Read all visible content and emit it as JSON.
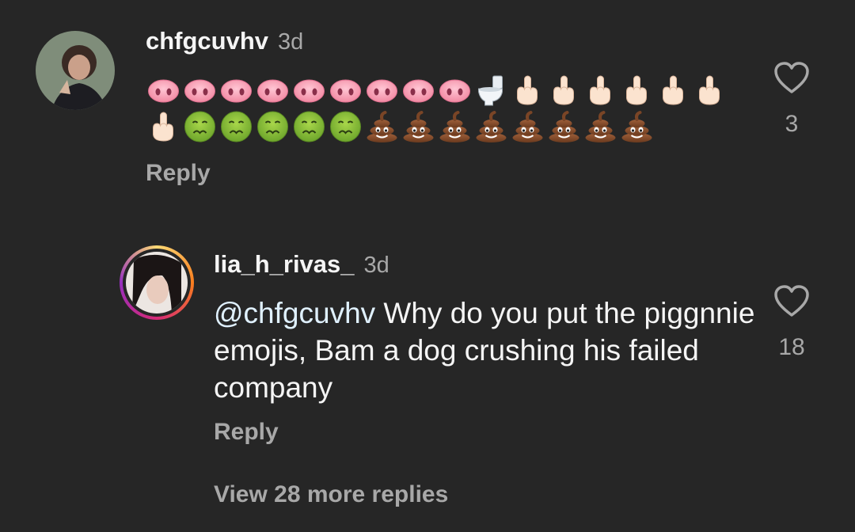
{
  "comments": [
    {
      "username": "chfgcuvhv",
      "time": "3d",
      "emoji_rows": [
        [
          "pig-nose-emoji",
          "pig-nose-emoji",
          "pig-nose-emoji",
          "pig-nose-emoji",
          "pig-nose-emoji",
          "pig-nose-emoji",
          "pig-nose-emoji",
          "pig-nose-emoji",
          "pig-nose-emoji",
          "toilet-emoji",
          "middle-finger-emoji",
          "middle-finger-emoji",
          "middle-finger-emoji",
          "middle-finger-emoji",
          "middle-finger-emoji",
          "middle-finger-emoji"
        ],
        [
          "middle-finger-emoji",
          "nauseated-face-emoji",
          "nauseated-face-emoji",
          "nauseated-face-emoji",
          "nauseated-face-emoji",
          "nauseated-face-emoji",
          "pile-of-poo-emoji",
          "pile-of-poo-emoji",
          "pile-of-poo-emoji",
          "pile-of-poo-emoji",
          "pile-of-poo-emoji",
          "pile-of-poo-emoji",
          "pile-of-poo-emoji",
          "pile-of-poo-emoji"
        ]
      ],
      "reply_label": "Reply",
      "likes": "3"
    },
    {
      "username": "lia_h_rivas_",
      "time": "3d",
      "mention": "@chfgcuvhv",
      "text": " Why do you put the piggnnie emojis, Bam a dog crushing his failed company",
      "reply_label": "Reply",
      "likes": "18",
      "has_story_ring": true
    }
  ],
  "view_more_label": "View 28 more replies",
  "colors": {
    "background": "#262626",
    "primary_text": "#f5f5f5",
    "secondary_text": "#a8a8a8",
    "mention": "#e0f1ff"
  }
}
